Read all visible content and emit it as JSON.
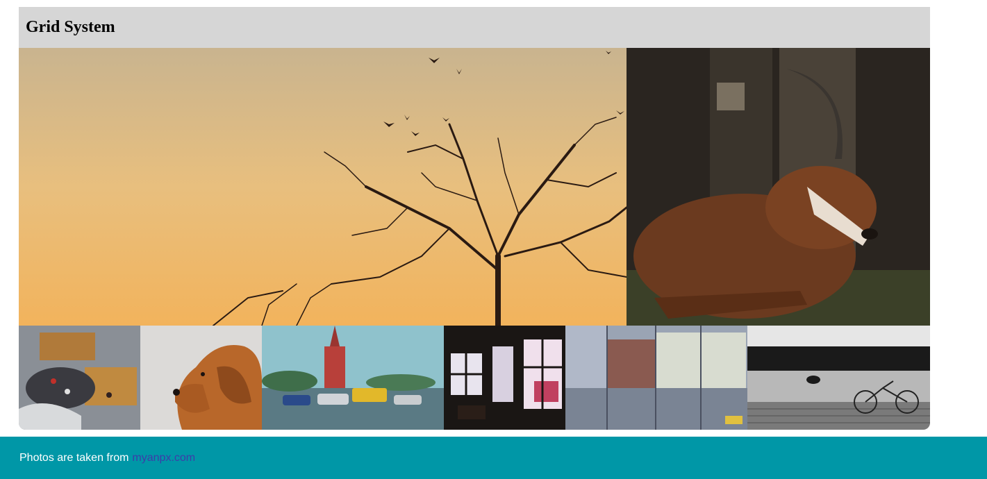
{
  "header": {
    "title": "Grid System"
  },
  "photos": [
    {
      "name": "sunset-tree",
      "alt": "Bare tree silhouette with birds at sunset"
    },
    {
      "name": "antelope",
      "alt": "Antelope with long curved horn resting"
    },
    {
      "name": "mall-food-court",
      "alt": "Busy mall food court seen from above"
    },
    {
      "name": "golden-dog",
      "alt": "Golden retriever profile"
    },
    {
      "name": "city-street",
      "alt": "Wet street with cars and red church tower"
    },
    {
      "name": "cafe-window",
      "alt": "Dark cafe interior with bright windows"
    },
    {
      "name": "glass-reflection",
      "alt": "City street reflected in glass facade"
    },
    {
      "name": "ship-bicycle",
      "alt": "Black and white ship deck with bicycle"
    }
  ],
  "footer": {
    "text": "Photos are taken from",
    "link_text": "myanpx.com"
  },
  "colors": {
    "header_bg": "#d6d6d6",
    "footer_bg": "#0097a7",
    "link": "#3d3ca8"
  }
}
